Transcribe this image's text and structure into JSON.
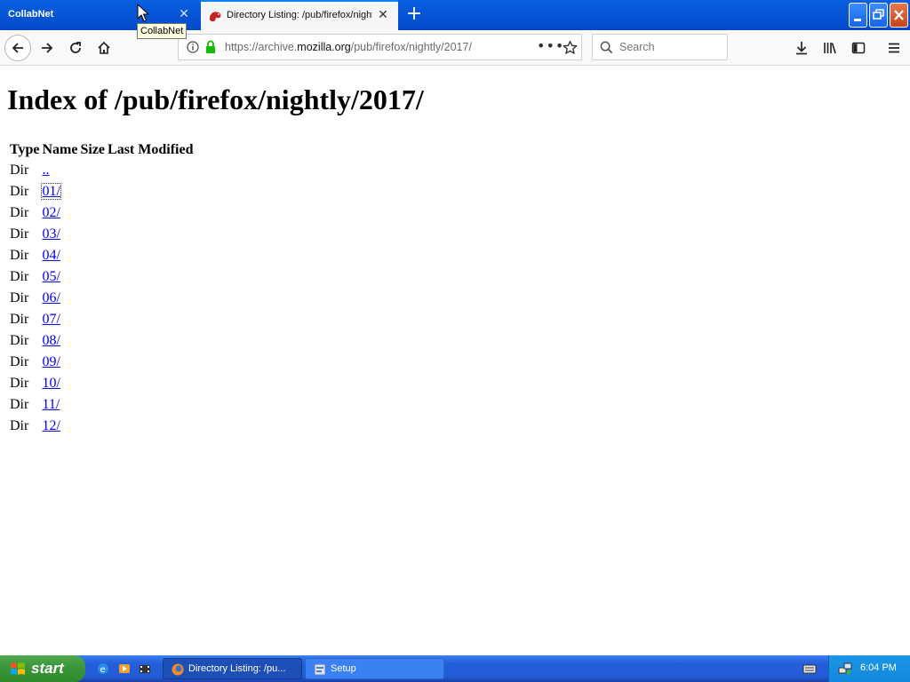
{
  "browser": {
    "tabs": [
      {
        "label": "CollabNet"
      },
      {
        "label": "Directory Listing: /pub/firefox/nightly"
      }
    ],
    "tooltip": "CollabNet",
    "url_prefix": "https://archive.",
    "url_domain": "mozilla.org",
    "url_path": "/pub/firefox/nightly/2017/",
    "search_placeholder": "Search"
  },
  "page": {
    "heading": "Index of /pub/firefox/nightly/2017/",
    "columns": [
      "Type",
      "Name",
      "Size",
      "Last Modified"
    ],
    "rows": [
      {
        "type": "Dir",
        "name": ".."
      },
      {
        "type": "Dir",
        "name": "01/"
      },
      {
        "type": "Dir",
        "name": "02/"
      },
      {
        "type": "Dir",
        "name": "03/"
      },
      {
        "type": "Dir",
        "name": "04/"
      },
      {
        "type": "Dir",
        "name": "05/"
      },
      {
        "type": "Dir",
        "name": "06/"
      },
      {
        "type": "Dir",
        "name": "07/"
      },
      {
        "type": "Dir",
        "name": "08/"
      },
      {
        "type": "Dir",
        "name": "09/"
      },
      {
        "type": "Dir",
        "name": "10/"
      },
      {
        "type": "Dir",
        "name": "11/"
      },
      {
        "type": "Dir",
        "name": "12/"
      }
    ]
  },
  "taskbar": {
    "start_label": "start",
    "items": [
      {
        "label": "Directory Listing: /pu..."
      },
      {
        "label": "Setup"
      }
    ],
    "clock": "6:04 PM"
  },
  "colors": {
    "link": "#0000ee",
    "titlebar": "#0553d4",
    "taskbar": "#245edb",
    "start": "#3c963b"
  }
}
